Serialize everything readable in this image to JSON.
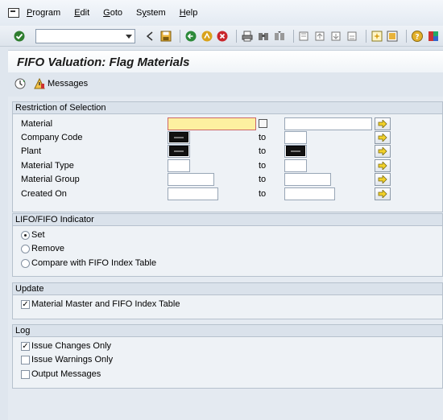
{
  "menu": {
    "items": [
      {
        "label": "Program",
        "accel": "P"
      },
      {
        "label": "Edit",
        "accel": "E"
      },
      {
        "label": "Goto",
        "accel": "G"
      },
      {
        "label": "System",
        "accel": "y"
      },
      {
        "label": "Help",
        "accel": "H"
      }
    ]
  },
  "toolbar": {
    "command_field_value": ""
  },
  "title": "FIFO Valuation: Flag Materials",
  "app_toolbar": {
    "messages_label": "Messages"
  },
  "selection": {
    "title": "Restriction of Selection",
    "to_label": "to",
    "rows": [
      {
        "label": "Material",
        "from": "",
        "to": ""
      },
      {
        "label": "Company Code",
        "from": "",
        "to": ""
      },
      {
        "label": "Plant",
        "from": "",
        "to": ""
      },
      {
        "label": "Material Type",
        "from": "",
        "to": ""
      },
      {
        "label": "Material Group",
        "from": "",
        "to": ""
      },
      {
        "label": "Created On",
        "from": "",
        "to": ""
      }
    ]
  },
  "indicator": {
    "title": "LIFO/FIFO Indicator",
    "options": [
      {
        "label": "Set",
        "selected": true
      },
      {
        "label": "Remove",
        "selected": false
      },
      {
        "label": "Compare with FIFO Index Table",
        "selected": false
      }
    ]
  },
  "update": {
    "title": "Update",
    "options": [
      {
        "label": "Material Master and FIFO Index Table",
        "checked": true
      }
    ]
  },
  "log": {
    "title": "Log",
    "options": [
      {
        "label": "Issue Changes Only",
        "checked": true
      },
      {
        "label": "Issue Warnings Only",
        "checked": false
      },
      {
        "label": "Output Messages",
        "checked": false
      }
    ]
  },
  "colors": {
    "required_field": "#fdf0a0",
    "background": "#dfe6ee"
  }
}
